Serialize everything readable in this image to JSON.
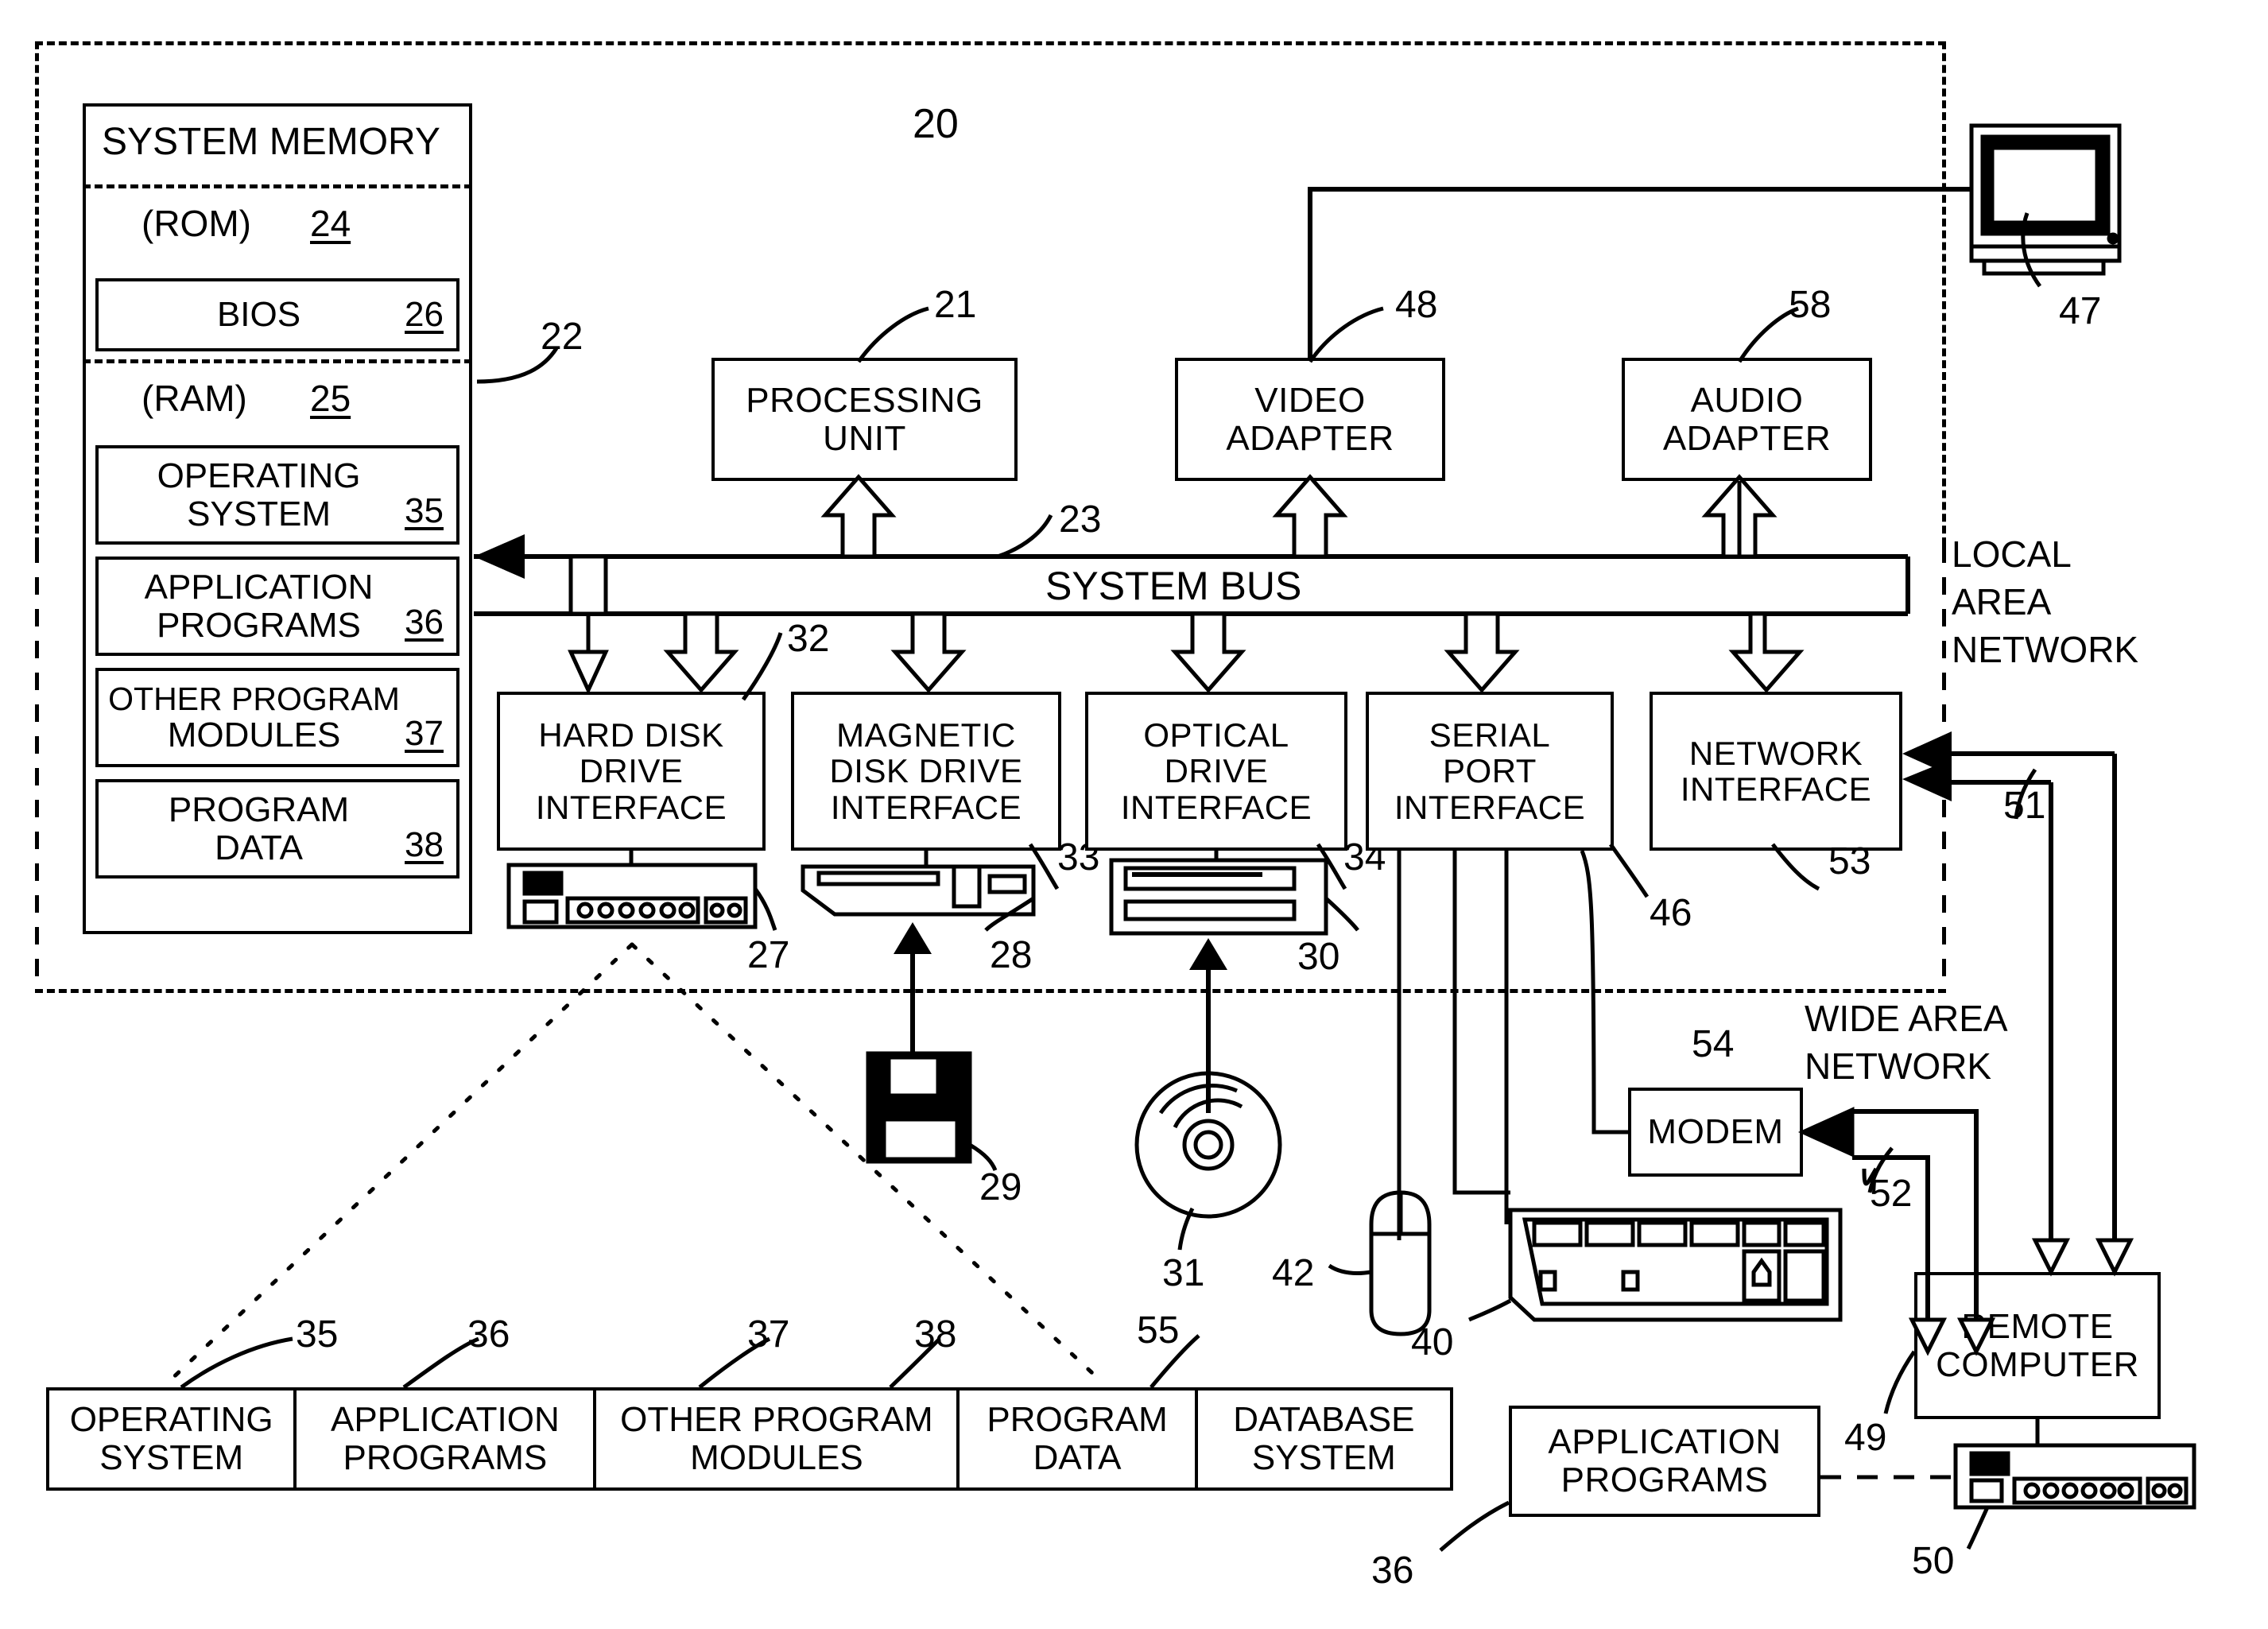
{
  "figure": {
    "main_ref": "20",
    "system_bus_label": "SYSTEM BUS",
    "system_bus_ref": "23",
    "memory_bus_ref": "22",
    "local_area_network": "LOCAL\nAREA\nNETWORK",
    "local_area_network_lines": [
      "LOCAL",
      "AREA",
      "NETWORK"
    ],
    "wide_area_network_lines": [
      "WIDE AREA",
      "NETWORK"
    ]
  },
  "system_memory": {
    "title": "SYSTEM MEMORY",
    "rom": {
      "label": "(ROM)",
      "ref": "24"
    },
    "bios": {
      "label": "BIOS",
      "ref": "26"
    },
    "ram": {
      "label": "(RAM)",
      "ref": "25"
    },
    "ram_blocks": [
      {
        "lines": [
          "OPERATING",
          "SYSTEM"
        ],
        "ref": "35"
      },
      {
        "lines": [
          "APPLICATION",
          "PROGRAMS"
        ],
        "ref": "36"
      },
      {
        "lines": [
          "OTHER PROGRAM",
          "MODULES"
        ],
        "ref": "37"
      },
      {
        "lines": [
          "PROGRAM",
          "DATA"
        ],
        "ref": "38"
      }
    ]
  },
  "top_boxes": [
    {
      "name": "processing-unit",
      "lines": [
        "PROCESSING",
        "UNIT"
      ],
      "ref": "21"
    },
    {
      "name": "video-adapter",
      "lines": [
        "VIDEO",
        "ADAPTER"
      ],
      "ref": "48"
    },
    {
      "name": "audio-adapter",
      "lines": [
        "AUDIO",
        "ADAPTER"
      ],
      "ref": "58"
    }
  ],
  "interfaces": [
    {
      "name": "hard-disk-drive-interface",
      "lines": [
        "HARD DISK",
        "DRIVE",
        "INTERFACE"
      ],
      "ref": "32"
    },
    {
      "name": "magnetic-disk-drive-interface",
      "lines": [
        "MAGNETIC",
        "DISK DRIVE",
        "INTERFACE"
      ],
      "ref": "33"
    },
    {
      "name": "optical-drive-interface",
      "lines": [
        "OPTICAL",
        "DRIVE",
        "INTERFACE"
      ],
      "ref": "34"
    },
    {
      "name": "serial-port-interface",
      "lines": [
        "SERIAL",
        "PORT",
        "INTERFACE"
      ],
      "ref": "46"
    },
    {
      "name": "network-interface",
      "lines": [
        "NETWORK",
        "INTERFACE"
      ],
      "ref": "53"
    }
  ],
  "devices": {
    "monitor_ref": "47",
    "hard_drive_ref": "27",
    "magnetic_drive_ref": "28",
    "floppy_disk_ref": "29",
    "optical_drive_ref": "30",
    "optical_disc_ref": "31",
    "mouse_ref": "42",
    "keyboard_ref": "40",
    "lan_link_ref": "51",
    "wan_link_ref": "52",
    "remote_hard_drive_ref": "50",
    "remote_computer_ref": "49"
  },
  "modem": {
    "label": "MODEM",
    "ref": "54"
  },
  "remote_computer": {
    "lines": [
      "REMOTE",
      "COMPUTER"
    ]
  },
  "remote_application_programs": {
    "lines": [
      "APPLICATION",
      "PROGRAMS"
    ],
    "ref": "36"
  },
  "storage_software_row": {
    "cells": [
      {
        "lines": [
          "OPERATING",
          "SYSTEM"
        ],
        "ref": "35"
      },
      {
        "lines": [
          "APPLICATION",
          "PROGRAMS"
        ],
        "ref": "36"
      },
      {
        "lines": [
          "OTHER PROGRAM",
          "MODULES"
        ],
        "ref": "37"
      },
      {
        "lines": [
          "PROGRAM",
          "DATA"
        ],
        "ref": "38"
      },
      {
        "lines": [
          "DATABASE",
          "SYSTEM"
        ],
        "ref": "55"
      }
    ]
  },
  "colors": {
    "ink": "#000000",
    "paper": "#ffffff"
  }
}
